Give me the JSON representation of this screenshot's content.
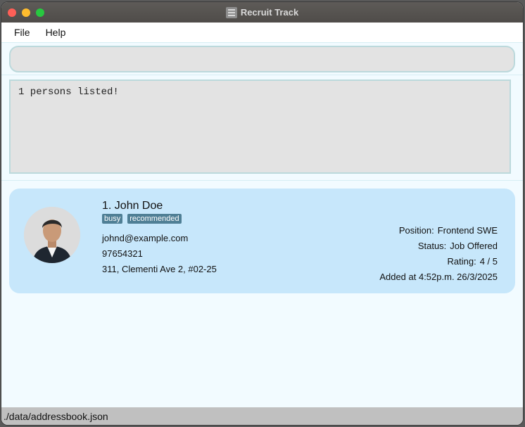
{
  "window": {
    "title": "Recruit Track"
  },
  "menu": {
    "file": "File",
    "help": "Help"
  },
  "command": {
    "value": "",
    "placeholder": ""
  },
  "result": {
    "text": "1 persons listed!"
  },
  "person": {
    "index_name": "1. John Doe",
    "tags": [
      "busy",
      "recommended"
    ],
    "email": "johnd@example.com",
    "phone": "97654321",
    "address": "311, Clementi Ave 2, #02-25",
    "position_label": "Position:",
    "position": "Frontend SWE",
    "status_label": "Status:",
    "status": "Job Offered",
    "rating_label": "Rating:",
    "rating": "4 / 5",
    "added": "Added at 4:52p.m. 26/3/2025"
  },
  "statusbar": {
    "path": "./data/addressbook.json"
  },
  "colors": {
    "card": "#c7e7fb",
    "tag": "#4f7f95",
    "window_bg": "#f2fbff"
  }
}
